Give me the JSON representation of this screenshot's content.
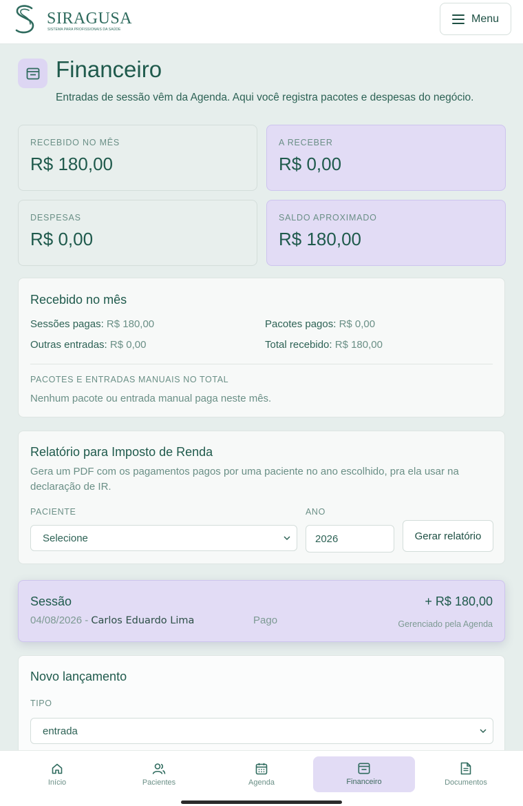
{
  "brand": {
    "name": "SIRAGUSA",
    "tagline": "SISTEMA PARA PROFISSIONAIS DA SAÚDE"
  },
  "header": {
    "menu_label": "Menu"
  },
  "page": {
    "title": "Financeiro",
    "subtitle": "Entradas de sessão vêm da Agenda. Aqui você registra pacotes e despesas do negócio."
  },
  "stats": [
    {
      "label": "RECEBIDO NO MÊS",
      "value": "R$ 180,00"
    },
    {
      "label": "A RECEBER",
      "value": "R$ 0,00"
    },
    {
      "label": "DESPESAS",
      "value": "R$ 0,00"
    },
    {
      "label": "SALDO APROXIMADO",
      "value": "R$ 180,00"
    }
  ],
  "received": {
    "title": "Recebido no mês",
    "sessions_label": "Sessões pagas:",
    "sessions_value": "R$ 180,00",
    "packages_label": "Pacotes pagos:",
    "packages_value": "R$ 0,00",
    "other_label": "Outras entradas:",
    "other_value": "R$ 0,00",
    "total_label": "Total recebido:",
    "total_value": "R$ 180,00",
    "section_label": "PACOTES E ENTRADAS MANUAIS NO TOTAL",
    "empty_text": "Nenhum pacote ou entrada manual paga neste mês."
  },
  "ir_report": {
    "title": "Relatório para Imposto de Renda",
    "description": "Gera um PDF com os pagamentos pagos por uma paciente no ano escolhido, pra ela usar na declaração de IR.",
    "patient_label": "PACIENTE",
    "patient_value": "Selecione",
    "year_label": "ANO",
    "year_value": "2026",
    "button_label": "Gerar relatório"
  },
  "session_entry": {
    "title": "Sessão",
    "date": "04/08/2026",
    "separator": "-",
    "patient": "Carlos Eduardo Lima",
    "status": "Pago",
    "amount": "+ R$ 180,00",
    "note": "Gerenciado pela Agenda"
  },
  "new_entry": {
    "title": "Novo lançamento",
    "type_label": "TIPO",
    "type_value": "entrada"
  },
  "nav": [
    {
      "label": "Início",
      "icon": "home-icon"
    },
    {
      "label": "Pacientes",
      "icon": "users-icon"
    },
    {
      "label": "Agenda",
      "icon": "calendar-icon"
    },
    {
      "label": "Financeiro",
      "icon": "wallet-icon",
      "active": true
    },
    {
      "label": "Documentos",
      "icon": "document-icon"
    }
  ]
}
